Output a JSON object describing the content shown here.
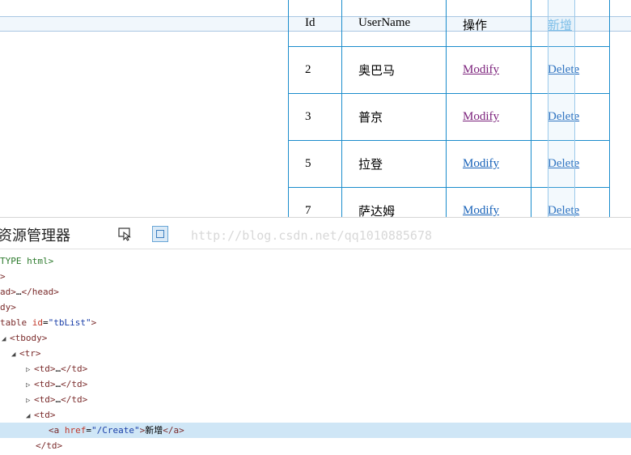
{
  "table": {
    "headers": [
      "Id",
      "UserName",
      "操作",
      "新增"
    ],
    "rows": [
      {
        "id": "2",
        "name": "奥巴马",
        "modify": "Modify",
        "delete": "Delete"
      },
      {
        "id": "3",
        "name": "普京",
        "modify": "Modify",
        "delete": "Delete"
      },
      {
        "id": "5",
        "name": "拉登",
        "modify": "Modify",
        "delete": "Delete"
      },
      {
        "id": "7",
        "name": "萨达姆",
        "modify": "Modify",
        "delete": "Delete"
      }
    ]
  },
  "devtools": {
    "title": "资源管理器",
    "watermark": "http://blog.csdn.net/qq1010885678",
    "tree": {
      "doctype": "TYPE html>",
      "l1": ">",
      "l2a": "ad>",
      "l2b": "…",
      "l2c": "</head>",
      "l3": "dy>",
      "l4_tag": "table",
      "l4_attr": "id",
      "l4_val": "\"tbList\"",
      "l5": "<tbody>",
      "l6": "<tr>",
      "td_open": "<td>",
      "td_ell": "…",
      "td_close": "</td>",
      "a_open": "<a ",
      "a_attr": "href",
      "a_val": "\"/Create\"",
      "a_text": "新增",
      "a_close": "</a>",
      "td_end": "</td>"
    }
  },
  "colors": {
    "table_border": "#1a8ccc",
    "visited_link": "#7a1f7a",
    "link": "#1560b8",
    "selected_row": "#cfe6f6"
  }
}
